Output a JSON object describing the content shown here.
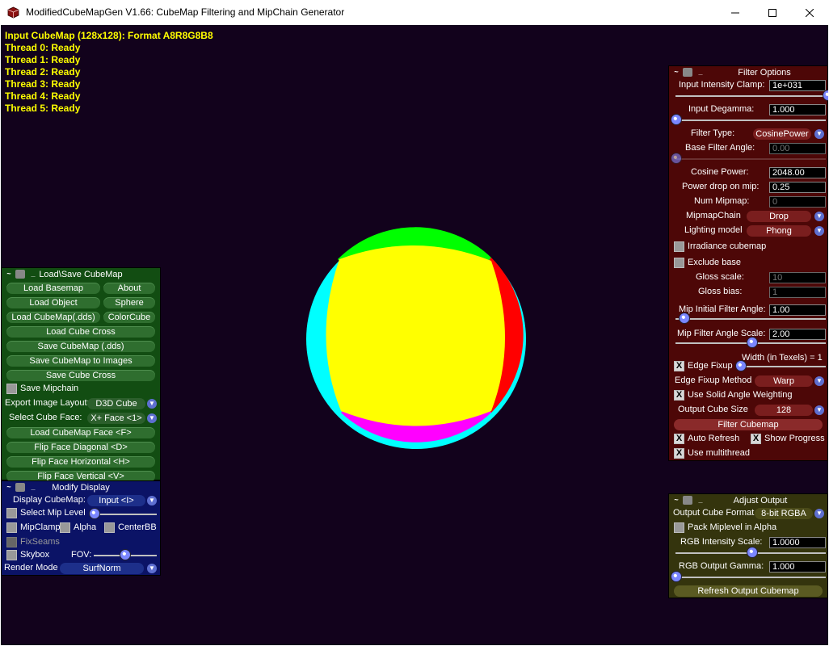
{
  "window": {
    "title": "ModifiedCubeMapGen V1.66: CubeMap Filtering and MipChain Generator",
    "minimize": "—",
    "maximize": "☐",
    "close": "✕"
  },
  "status_lines": [
    "Input CubeMap (128x128): Format A8R8G8B8",
    "Thread 0: Ready",
    "Thread 1: Ready",
    "Thread 2: Ready",
    "Thread 3: Ready",
    "Thread 4: Ready",
    "Thread 5: Ready"
  ],
  "colors": {
    "viewport_bg": "#12021c",
    "status_text": "#ffff00",
    "sphere_yellow": "#ffff00",
    "sphere_green": "#00ff00",
    "sphere_red": "#ff0000",
    "sphere_cyan": "#00ffff",
    "sphere_magenta": "#ff00ff",
    "panel_green": "#124d12",
    "panel_red": "#4d0707",
    "panel_blue": "#0b1366",
    "panel_olive": "#34340d"
  },
  "header_buttons": {
    "tilde": "~",
    "underscore": "_"
  },
  "load_save": {
    "title": "Load\\Save CubeMap",
    "load_basemap": "Load Basemap",
    "about": "About",
    "load_object": "Load Object",
    "sphere": "Sphere",
    "load_cubemap_dds": "Load CubeMap(.dds)",
    "color_cube": "ColorCube",
    "load_cube_cross": "Load Cube Cross",
    "save_cubemap_dds": "Save CubeMap (.dds)",
    "save_cubemap_images": "Save CubeMap to Images",
    "save_cube_cross": "Save Cube Cross",
    "save_mipchain": "Save Mipchain",
    "export_layout_label": "Export Image Layout:",
    "export_layout_value": "D3D Cube",
    "select_face_label": "Select Cube Face:",
    "select_face_value": "X+ Face <1>",
    "load_cubemap_face": "Load CubeMap Face  <F>",
    "flip_diagonal": "Flip Face Diagonal  <D>",
    "flip_horizontal": "Flip Face Horizontal  <H>",
    "flip_vertical": "Flip Face Vertical  <V>"
  },
  "modify_display": {
    "title": "Modify Display",
    "display_cubemap_label": "Display CubeMap:",
    "display_cubemap_value": "Input <I>",
    "select_mip_level": "Select Mip Level",
    "mip_clamp": "MipClamp",
    "alpha": "Alpha",
    "center_bb": "CenterBB",
    "fix_seams": "FixSeams",
    "skybox": "Skybox",
    "fov": "FOV:",
    "render_mode_label": "Render Mode",
    "render_mode_value": "SurfNorm"
  },
  "filter_options": {
    "title": "Filter Options",
    "input_clamp_label": "Input Intensity Clamp:",
    "input_clamp_value": "1e+031",
    "input_degamma_label": "Input Degamma:",
    "input_degamma_value": "1.000",
    "filter_type_label": "Filter Type:",
    "filter_type_value": "CosinePower",
    "base_angle_label": "Base Filter Angle:",
    "base_angle_value": "0.00",
    "cosine_power_label": "Cosine Power:",
    "cosine_power_value": "2048.00",
    "power_drop_label": "Power drop on mip:",
    "power_drop_value": "0.25",
    "num_mipmap_label": "Num Mipmap:",
    "num_mipmap_value": "0",
    "mipmapchain_label": "MipmapChain",
    "mipmapchain_value": "Drop",
    "lighting_label": "Lighting model",
    "lighting_value": "Phong",
    "irradiance": "Irradiance cubemap",
    "exclude_base": "Exclude base",
    "gloss_scale_label": "Gloss scale:",
    "gloss_scale_value": "10",
    "gloss_bias_label": "Gloss bias:",
    "gloss_bias_value": "1",
    "mip_initial_label": "Mip Initial Filter Angle:",
    "mip_initial_value": "1.00",
    "mip_scale_label": "Mip Filter Angle Scale:",
    "mip_scale_value": "2.00",
    "edge_width_label": "Width (in Texels) = 1",
    "edge_fixup": "Edge Fixup",
    "edge_method_label": "Edge Fixup Method",
    "edge_method_value": "Warp",
    "solid_angle": "Use Solid Angle Weighting",
    "output_size_label": "Output Cube Size",
    "output_size_value": "128",
    "filter_cubemap": "Filter Cubemap",
    "auto_refresh": "Auto Refresh",
    "show_progress": "Show Progress",
    "use_multithread": "Use multithread",
    "check_mark": "X"
  },
  "adjust_output": {
    "title": "Adjust Output",
    "format_label": "Output Cube Format",
    "format_value": "8-bit RGBA",
    "pack_miplevel": "Pack Miplevel in Alpha",
    "rgb_scale_label": "RGB Intensity Scale:",
    "rgb_scale_value": "1.0000",
    "rgb_gamma_label": "RGB Output Gamma:",
    "rgb_gamma_value": "1.000",
    "refresh": "Refresh Output Cubemap"
  },
  "icons": {
    "arrow": "▼"
  }
}
